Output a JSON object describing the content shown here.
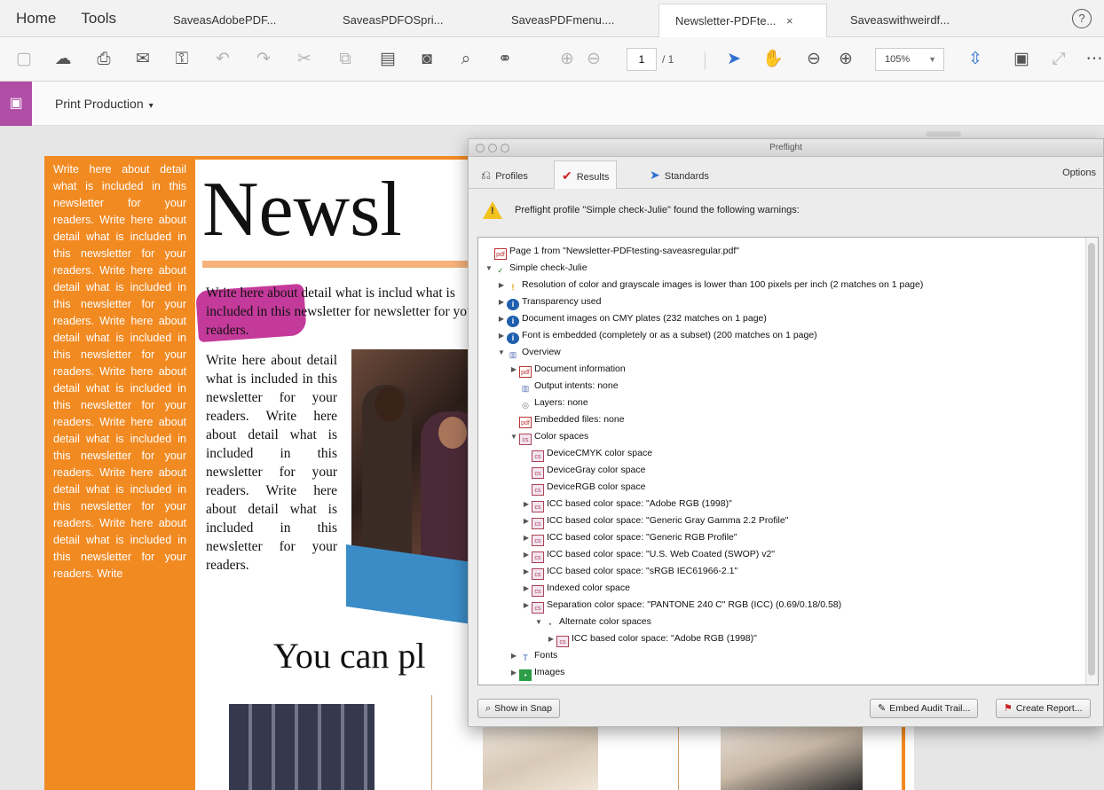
{
  "tabbar": {
    "home": "Home",
    "tools": "Tools",
    "tabs": [
      {
        "label": "SaveasAdobePDF...",
        "active": false
      },
      {
        "label": "SaveasPDFOSpri...",
        "active": false
      },
      {
        "label": "SaveasPDFmenu....",
        "active": false
      },
      {
        "label": "Newsletter-PDFte...",
        "active": true
      },
      {
        "label": "Saveaswithweirdf...",
        "active": false
      }
    ],
    "close_glyph": "×",
    "help": "?"
  },
  "toolbar": {
    "page_current": "1",
    "page_total": "/ 1",
    "zoom": "105%"
  },
  "toolrow": {
    "title": "Print Production",
    "caret": "▾"
  },
  "document": {
    "headline": "Newsl",
    "sidebar_text": "Write here about detail what is included in this newsletter for your readers. Write here about detail what is included in this newsletter for your readers. Write here about detail what is included in this newsletter for your readers. Write here about detail what is included in this newsletter for your readers. Write here about detail what is included in this newsletter for your readers. Write here about detail what is included in this newsletter for your readers. Write here about detail what is included in this newsletter for your readers. Write here about detail what is included in this newsletter for your readers. Write",
    "intro_text": "Write here about detail what is includ what is included in this newsletter for newsletter for your readers.",
    "body_text": "Write here about detail what is included in this newsletter for your readers. Write here about detail what is included in this newsletter for your readers. Write here about detail what is included in this newsletter for your readers.",
    "subhead": "You can pl"
  },
  "preflight": {
    "title": "Preflight",
    "tabs": {
      "profiles": "Profiles",
      "results": "Results",
      "standards": "Standards"
    },
    "options": "Options",
    "warning": "Preflight profile \"Simple check-Julie\" found the following warnings:",
    "tree": [
      {
        "text": "Page 1 from \"Newsletter-PDFtesting-saveasregular.pdf\"",
        "icon": "doc",
        "depth": 0,
        "twisty": ""
      },
      {
        "text": "Simple check-Julie",
        "icon": "green",
        "depth": 0,
        "twisty": "▼"
      },
      {
        "text": "Resolution of color and grayscale images is lower than 100 pixels per inch (2 matches on 1 page)",
        "icon": "warn",
        "depth": 1,
        "twisty": "▶"
      },
      {
        "text": "Transparency used",
        "icon": "info",
        "depth": 1,
        "twisty": "▶"
      },
      {
        "text": "Document images on CMY plates (232 matches on 1 page)",
        "icon": "info",
        "depth": 1,
        "twisty": "▶"
      },
      {
        "text": "Font is embedded (completely or as a subset) (200 matches on 1 page)",
        "icon": "info",
        "depth": 1,
        "twisty": "▶"
      },
      {
        "text": "Overview",
        "icon": "chart",
        "depth": 1,
        "twisty": "▼"
      },
      {
        "text": "Document information",
        "icon": "doc",
        "depth": 2,
        "twisty": "▶"
      },
      {
        "text": "Output intents: none",
        "icon": "chart",
        "depth": 2,
        "twisty": ""
      },
      {
        "text": "Layers: none",
        "icon": "layer",
        "depth": 2,
        "twisty": ""
      },
      {
        "text": "Embedded files: none",
        "icon": "doc",
        "depth": 2,
        "twisty": ""
      },
      {
        "text": "Color spaces",
        "icon": "cs",
        "depth": 2,
        "twisty": "▼"
      },
      {
        "text": "DeviceCMYK color space",
        "icon": "cs",
        "depth": 3,
        "twisty": ""
      },
      {
        "text": "DeviceGray color space",
        "icon": "cs",
        "depth": 3,
        "twisty": ""
      },
      {
        "text": "DeviceRGB color space",
        "icon": "cs",
        "depth": 3,
        "twisty": ""
      },
      {
        "text": "ICC based color space: \"Adobe RGB (1998)\"",
        "icon": "cs",
        "depth": 3,
        "twisty": "▶"
      },
      {
        "text": "ICC based color space: \"Generic Gray Gamma 2.2 Profile\"",
        "icon": "cs",
        "depth": 3,
        "twisty": "▶"
      },
      {
        "text": "ICC based color space: \"Generic RGB Profile\"",
        "icon": "cs",
        "depth": 3,
        "twisty": "▶"
      },
      {
        "text": "ICC based color space: \"U.S. Web Coated (SWOP) v2\"",
        "icon": "cs",
        "depth": 3,
        "twisty": "▶"
      },
      {
        "text": "ICC based color space: \"sRGB IEC61966-2.1\"",
        "icon": "cs",
        "depth": 3,
        "twisty": "▶"
      },
      {
        "text": "Indexed color space",
        "icon": "cs",
        "depth": 3,
        "twisty": "▶"
      },
      {
        "text": "Separation color space: \"PANTONE 240 C\" RGB (ICC) (0.69/0.18/0.58)",
        "icon": "cs",
        "depth": 3,
        "twisty": "▶"
      },
      {
        "text": "Alternate color spaces",
        "icon": "dot",
        "depth": 4,
        "twisty": "▼"
      },
      {
        "text": "ICC based color space: \"Adobe RGB (1998)\"",
        "icon": "cs",
        "depth": 5,
        "twisty": "▶"
      },
      {
        "text": "Fonts",
        "icon": "font",
        "depth": 2,
        "twisty": "▶"
      },
      {
        "text": "Images",
        "icon": "img",
        "depth": 2,
        "twisty": "▶"
      }
    ],
    "buttons": {
      "show_in_snap": "Show in Snap",
      "embed_audit": "Embed Audit Trail...",
      "create_report": "Create Report..."
    }
  },
  "colors": {
    "accent_orange": "#f28a22",
    "tool_purple": "#b04ea6",
    "info_blue": "#1f5fae",
    "warning_yellow": "#f4c21c"
  }
}
